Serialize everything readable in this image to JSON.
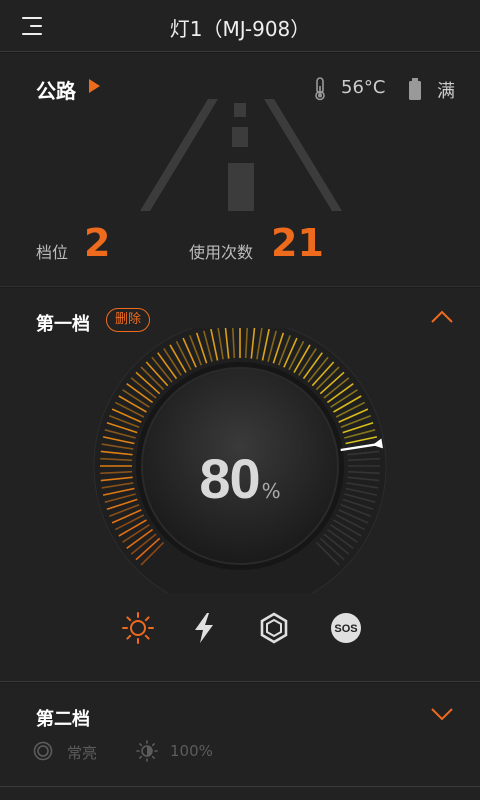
{
  "header": {
    "title": "灯1（MJ-908）"
  },
  "status": {
    "mode_label": "公路",
    "temperature": "56°C",
    "battery": "满",
    "gear_label": "档位",
    "gear_value": "2",
    "uses_label": "使用次数",
    "uses_value": "21"
  },
  "level1": {
    "title": "第一档",
    "delete_label": "删除",
    "brightness_number": "80",
    "brightness_unit": "%",
    "brightness_fraction": 0.8,
    "modes": [
      "light-icon",
      "flash-icon",
      "strobe-icon",
      "sos-icon"
    ],
    "selected_mode": "light-icon",
    "sos_text": "SOS"
  },
  "level2": {
    "title": "第二档",
    "mode_label": "常亮",
    "brightness": "100%"
  },
  "colors": {
    "accent": "#ee6b1e",
    "dial_yellow": "#d8c21a",
    "background": "#222222"
  }
}
